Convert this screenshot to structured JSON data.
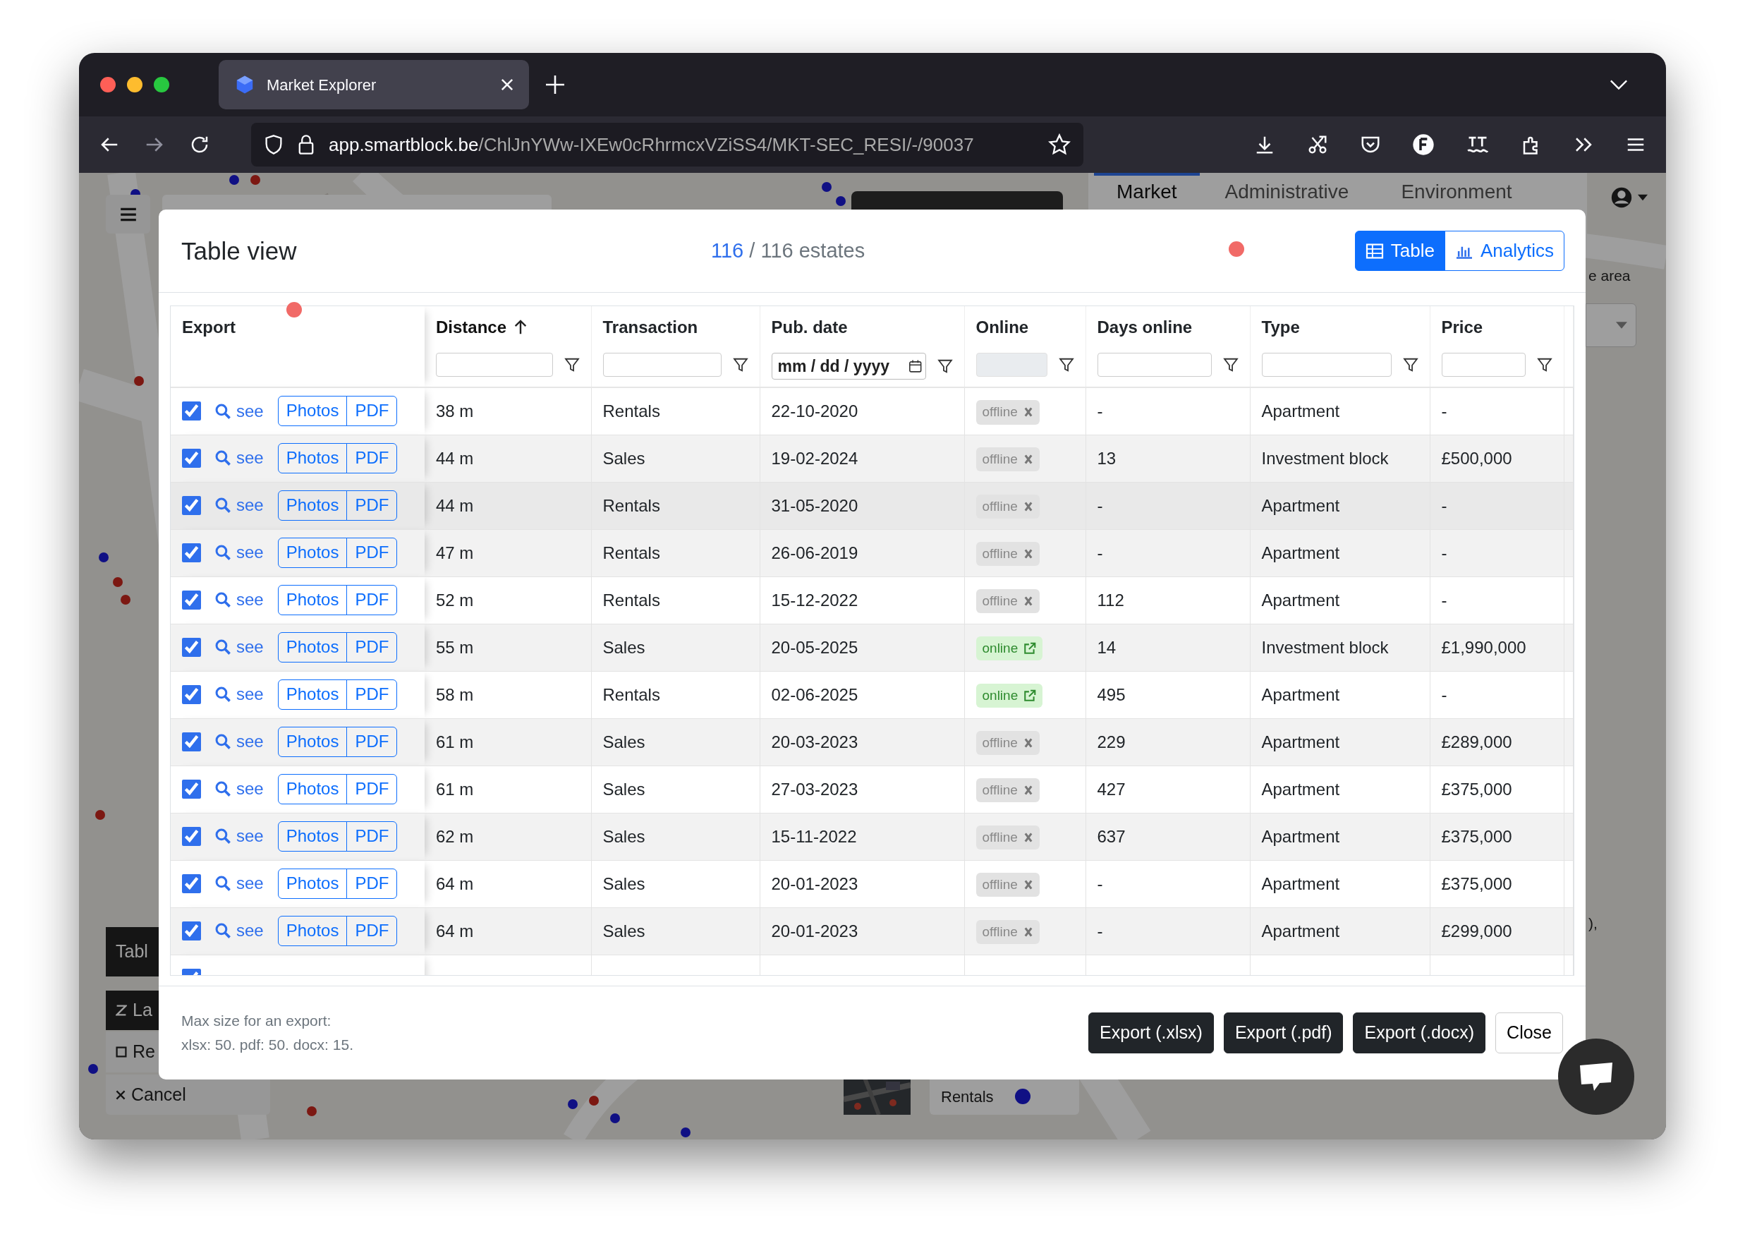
{
  "browser": {
    "tab_title": "Market Explorer",
    "url_host": "app.smartblock.be",
    "url_path": "/ChlJnYWw-IXEw0cRhrmcxVZiSS4/MKT-SEC_RESI/-/90037"
  },
  "background": {
    "tabs": [
      {
        "label": "Market",
        "selected": true
      },
      {
        "label": "Administrative",
        "selected": false
      },
      {
        "label": "Environment",
        "selected": false
      }
    ],
    "area_text": "e area",
    "tail_text": "),",
    "side_items": [
      {
        "kind": "dark",
        "label": "Tabl"
      },
      {
        "kind": "dark",
        "label": "La"
      },
      {
        "kind": "check",
        "label": "Re"
      },
      {
        "kind": "cancel",
        "label": "Cancel"
      }
    ],
    "legend_label": "Rentals"
  },
  "modal": {
    "title": "Table view",
    "count_shown": "116",
    "count_rest": "/ 116 estates",
    "views": [
      {
        "label": "Table",
        "selected": true
      },
      {
        "label": "Analytics",
        "selected": false
      }
    ],
    "columns": [
      {
        "label": "Export",
        "kind": "none",
        "sorted": false
      },
      {
        "label": "Distance",
        "kind": "text",
        "sorted": true
      },
      {
        "label": "Transaction",
        "kind": "text",
        "sorted": false
      },
      {
        "label": "Pub. date",
        "kind": "date",
        "sorted": false,
        "placeholder": "mm / dd / yyyy"
      },
      {
        "label": "Online",
        "kind": "disabled",
        "sorted": false
      },
      {
        "label": "Days online",
        "kind": "text",
        "sorted": false
      },
      {
        "label": "Type",
        "kind": "text",
        "sorted": false
      },
      {
        "label": "Price",
        "kind": "text",
        "sorted": false
      }
    ],
    "rows": [
      {
        "checked": true,
        "hovered": false,
        "see": "see",
        "photos": "Photos",
        "pdf": "PDF",
        "distance": "38 m",
        "transaction": "Rentals",
        "date": "22-10-2020",
        "status": "offline",
        "days": "-",
        "type": "Apartment",
        "price": "-"
      },
      {
        "checked": true,
        "hovered": false,
        "see": "see",
        "photos": "Photos",
        "pdf": "PDF",
        "distance": "44 m",
        "transaction": "Sales",
        "date": "19-02-2024",
        "status": "offline",
        "days": "13",
        "type": "Investment block",
        "price": "£500,000"
      },
      {
        "checked": true,
        "hovered": true,
        "see": "see",
        "photos": "Photos",
        "pdf": "PDF",
        "distance": "44 m",
        "transaction": "Rentals",
        "date": "31-05-2020",
        "status": "offline",
        "days": "-",
        "type": "Apartment",
        "price": "-"
      },
      {
        "checked": true,
        "hovered": false,
        "see": "see",
        "photos": "Photos",
        "pdf": "PDF",
        "distance": "47 m",
        "transaction": "Rentals",
        "date": "26-06-2019",
        "status": "offline",
        "days": "-",
        "type": "Apartment",
        "price": "-"
      },
      {
        "checked": true,
        "hovered": false,
        "see": "see",
        "photos": "Photos",
        "pdf": "PDF",
        "distance": "52 m",
        "transaction": "Rentals",
        "date": "15-12-2022",
        "status": "offline",
        "days": "112",
        "type": "Apartment",
        "price": "-"
      },
      {
        "checked": true,
        "hovered": false,
        "see": "see",
        "photos": "Photos",
        "pdf": "PDF",
        "distance": "55 m",
        "transaction": "Sales",
        "date": "20-05-2025",
        "status": "online",
        "days": "14",
        "type": "Investment block",
        "price": "£1,990,000"
      },
      {
        "checked": true,
        "hovered": false,
        "see": "see",
        "photos": "Photos",
        "pdf": "PDF",
        "distance": "58 m",
        "transaction": "Rentals",
        "date": "02-06-2025",
        "status": "online",
        "days": "495",
        "type": "Apartment",
        "price": "-"
      },
      {
        "checked": true,
        "hovered": false,
        "see": "see",
        "photos": "Photos",
        "pdf": "PDF",
        "distance": "61 m",
        "transaction": "Sales",
        "date": "20-03-2023",
        "status": "offline",
        "days": "229",
        "type": "Apartment",
        "price": "£289,000"
      },
      {
        "checked": true,
        "hovered": false,
        "see": "see",
        "photos": "Photos",
        "pdf": "PDF",
        "distance": "61 m",
        "transaction": "Sales",
        "date": "27-03-2023",
        "status": "offline",
        "days": "427",
        "type": "Apartment",
        "price": "£375,000"
      },
      {
        "checked": true,
        "hovered": false,
        "see": "see",
        "photos": "Photos",
        "pdf": "PDF",
        "distance": "62 m",
        "transaction": "Sales",
        "date": "15-11-2022",
        "status": "offline",
        "days": "637",
        "type": "Apartment",
        "price": "£375,000"
      },
      {
        "checked": true,
        "hovered": false,
        "see": "see",
        "photos": "Photos",
        "pdf": "PDF",
        "distance": "64 m",
        "transaction": "Sales",
        "date": "20-01-2023",
        "status": "offline",
        "days": "-",
        "type": "Apartment",
        "price": "£375,000"
      },
      {
        "checked": true,
        "hovered": false,
        "see": "see",
        "photos": "Photos",
        "pdf": "PDF",
        "distance": "64 m",
        "transaction": "Sales",
        "date": "20-01-2023",
        "status": "offline",
        "days": "-",
        "type": "Apartment",
        "price": "£299,000"
      }
    ],
    "partial_row": {
      "checked": true
    },
    "note": "Max size for an export:\nxlsx: 50. pdf: 50. docx: 15.",
    "buttons": [
      {
        "label": "Export (.xlsx)",
        "kind": "dark"
      },
      {
        "label": "Export (.pdf)",
        "kind": "dark"
      },
      {
        "label": "Export (.docx)",
        "kind": "dark"
      },
      {
        "label": "Close",
        "kind": "light"
      }
    ]
  }
}
